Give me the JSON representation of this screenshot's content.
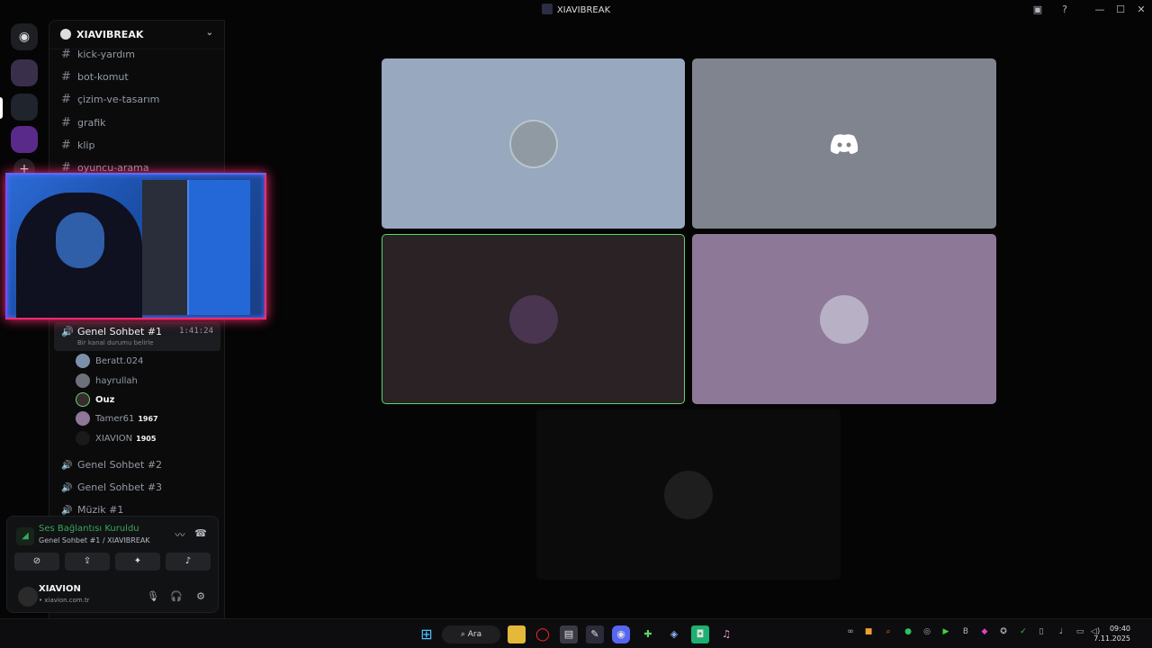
{
  "window": {
    "title": "XIAVIBREAK"
  },
  "server": {
    "name": "XIAVIBREAK"
  },
  "channels": {
    "text": [
      "kick-yardım",
      "bot-komut",
      "çizim-ve-tasarım",
      "grafik",
      "klip",
      "oyuncu-arama"
    ],
    "voice_active": {
      "name": "Genel Sohbet #1",
      "timer": "1:41:24",
      "status": "Bir kanal durumu belirle"
    },
    "voice_users": [
      {
        "name": "Beratt.024",
        "badge": ""
      },
      {
        "name": "hayrullah",
        "badge": ""
      },
      {
        "name": "Ouz",
        "badge": ""
      },
      {
        "name": "Tamer61",
        "badge": "1967"
      },
      {
        "name": "XIAVION",
        "badge": "1905"
      }
    ],
    "voice_other": [
      "Genel Sohbet #2",
      "Genel Sohbet #3",
      "Müzik #1"
    ]
  },
  "voice_panel": {
    "connection": "Ses Bağlantısı Kuruldu",
    "location": "Genel Sohbet #1 / XIAVIBREAK"
  },
  "user": {
    "name": "XIAVION",
    "status": "• xiavion.com.tr"
  },
  "taskbar": {
    "search_label": "Ara",
    "time": "09:40",
    "date": "7.11.2025"
  },
  "colors": {
    "connected_green": "#3ba55c",
    "speaking_border": "#5bd76a",
    "blurple": "#5865f2"
  }
}
